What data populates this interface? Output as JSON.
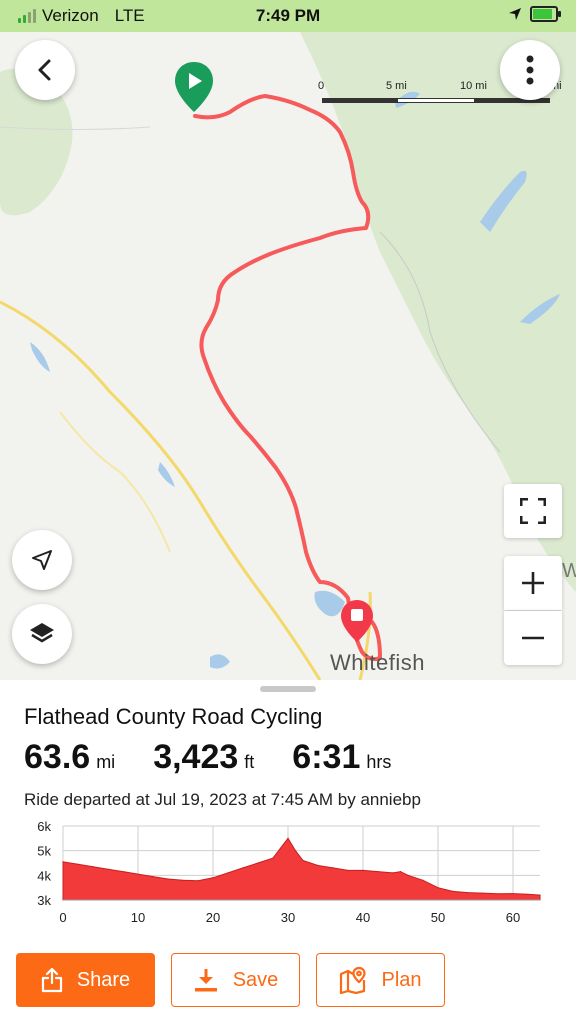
{
  "status_bar": {
    "carrier": "Verizon",
    "network": "LTE",
    "time": "7:49 PM",
    "background_color": "#bfe69a"
  },
  "map": {
    "scale": {
      "labels": [
        "0",
        "5 mi",
        "10 mi",
        "mi"
      ]
    },
    "town_label": "Whitefish",
    "edge_label": "W",
    "route_color": "#f65a5a",
    "start_marker_color": "#1a9c5b",
    "end_marker_color": "#f2394a",
    "icons": {
      "back": "chevron-left-icon",
      "more": "more-vertical-icon",
      "fullscreen": "fullscreen-icon",
      "locate": "navigation-arrow-icon",
      "layers": "layers-icon",
      "zoom_in": "plus-icon",
      "zoom_out": "minus-icon"
    }
  },
  "ride": {
    "title": "Flathead County Road Cycling",
    "distance": {
      "value": "63.6",
      "unit": "mi"
    },
    "elevation": {
      "value": "3,423",
      "unit": "ft"
    },
    "duration": {
      "value": "6:31",
      "unit": "hrs"
    },
    "description": "Ride departed at Jul 19, 2023 at 7:45 AM by anniebp"
  },
  "chart_data": {
    "type": "area",
    "title": "",
    "xlabel": "",
    "ylabel": "",
    "x_ticks": [
      "0",
      "10",
      "20",
      "30",
      "40",
      "50",
      "60"
    ],
    "y_ticks": [
      "3k",
      "4k",
      "5k",
      "6k"
    ],
    "xlim": [
      0,
      63.6
    ],
    "ylim": [
      3000,
      6000
    ],
    "grid": true,
    "color": "#f23a3a",
    "x": [
      0,
      2,
      4,
      6,
      8,
      10,
      12,
      14,
      16,
      18,
      20,
      22,
      24,
      26,
      28,
      29,
      30,
      31,
      32,
      34,
      36,
      38,
      40,
      42,
      44,
      45,
      46,
      48,
      50,
      52,
      54,
      56,
      58,
      60,
      62,
      63.6
    ],
    "y": [
      4550,
      4450,
      4350,
      4250,
      4150,
      4050,
      3950,
      3850,
      3800,
      3780,
      3900,
      4100,
      4300,
      4500,
      4700,
      5100,
      5500,
      5000,
      4600,
      4400,
      4300,
      4200,
      4200,
      4150,
      4100,
      4150,
      4000,
      3800,
      3500,
      3350,
      3300,
      3280,
      3250,
      3260,
      3230,
      3200
    ]
  },
  "actions": {
    "share": "Share",
    "save": "Save",
    "plan": "Plan",
    "accent_color": "#fc6a15"
  }
}
